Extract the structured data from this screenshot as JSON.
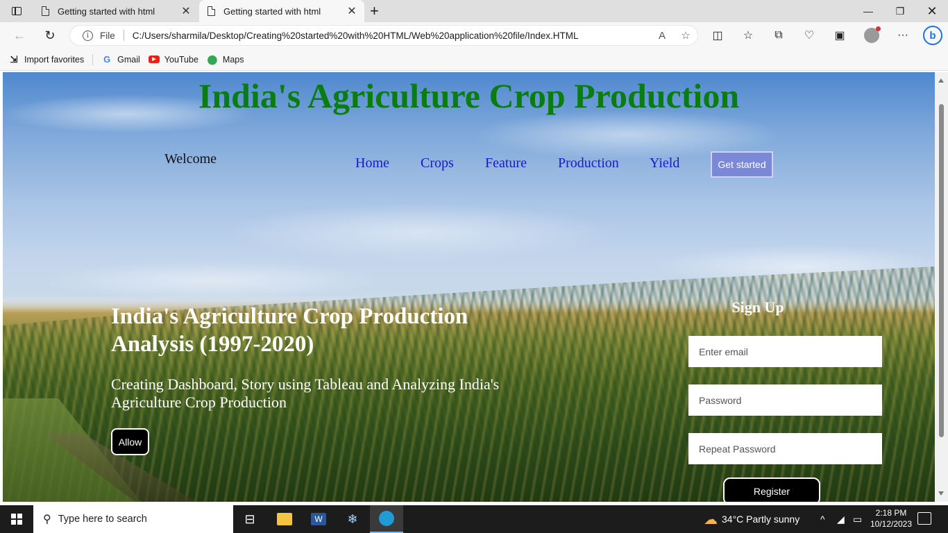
{
  "browser": {
    "tabs": [
      {
        "title": "Getting started with html",
        "active": false
      },
      {
        "title": "Getting started with html",
        "active": true
      }
    ],
    "protocol_label": "File",
    "url": "C:/Users/sharmila/Desktop/Creating%20started%20with%20HTML/Web%20application%20file/Index.HTML",
    "favorites": [
      {
        "label": "Import favorites",
        "icon": "import-icon"
      },
      {
        "label": "Gmail",
        "icon": "google-icon"
      },
      {
        "label": "YouTube",
        "icon": "youtube-icon"
      },
      {
        "label": "Maps",
        "icon": "maps-icon"
      }
    ]
  },
  "page": {
    "site_title": "India's Agriculture Crop Production",
    "welcome": "Welcome",
    "nav": [
      "Home",
      "Crops",
      "Feature",
      "Production",
      "Yield"
    ],
    "get_started": "Get started",
    "hero_title": "India's Agriculture Crop Production Analysis (1997-2020)",
    "hero_subtitle": "Creating Dashboard, Story using Tableau and Analyzing India's Agriculture Crop Production",
    "allow_button": "Allow",
    "signup": {
      "title": "Sign Up",
      "email_placeholder": "Enter email",
      "password_placeholder": "Password",
      "repeat_placeholder": "Repeat Password",
      "register_button": "Register"
    },
    "colors": {
      "title_green": "#0a7d12",
      "nav_blue": "#1a1ac8",
      "button_purple": "#7b88d8"
    }
  },
  "taskbar": {
    "search_placeholder": "Type here to search",
    "weather": "34°C  Partly sunny",
    "time": "2:18 PM",
    "date": "10/12/2023"
  }
}
